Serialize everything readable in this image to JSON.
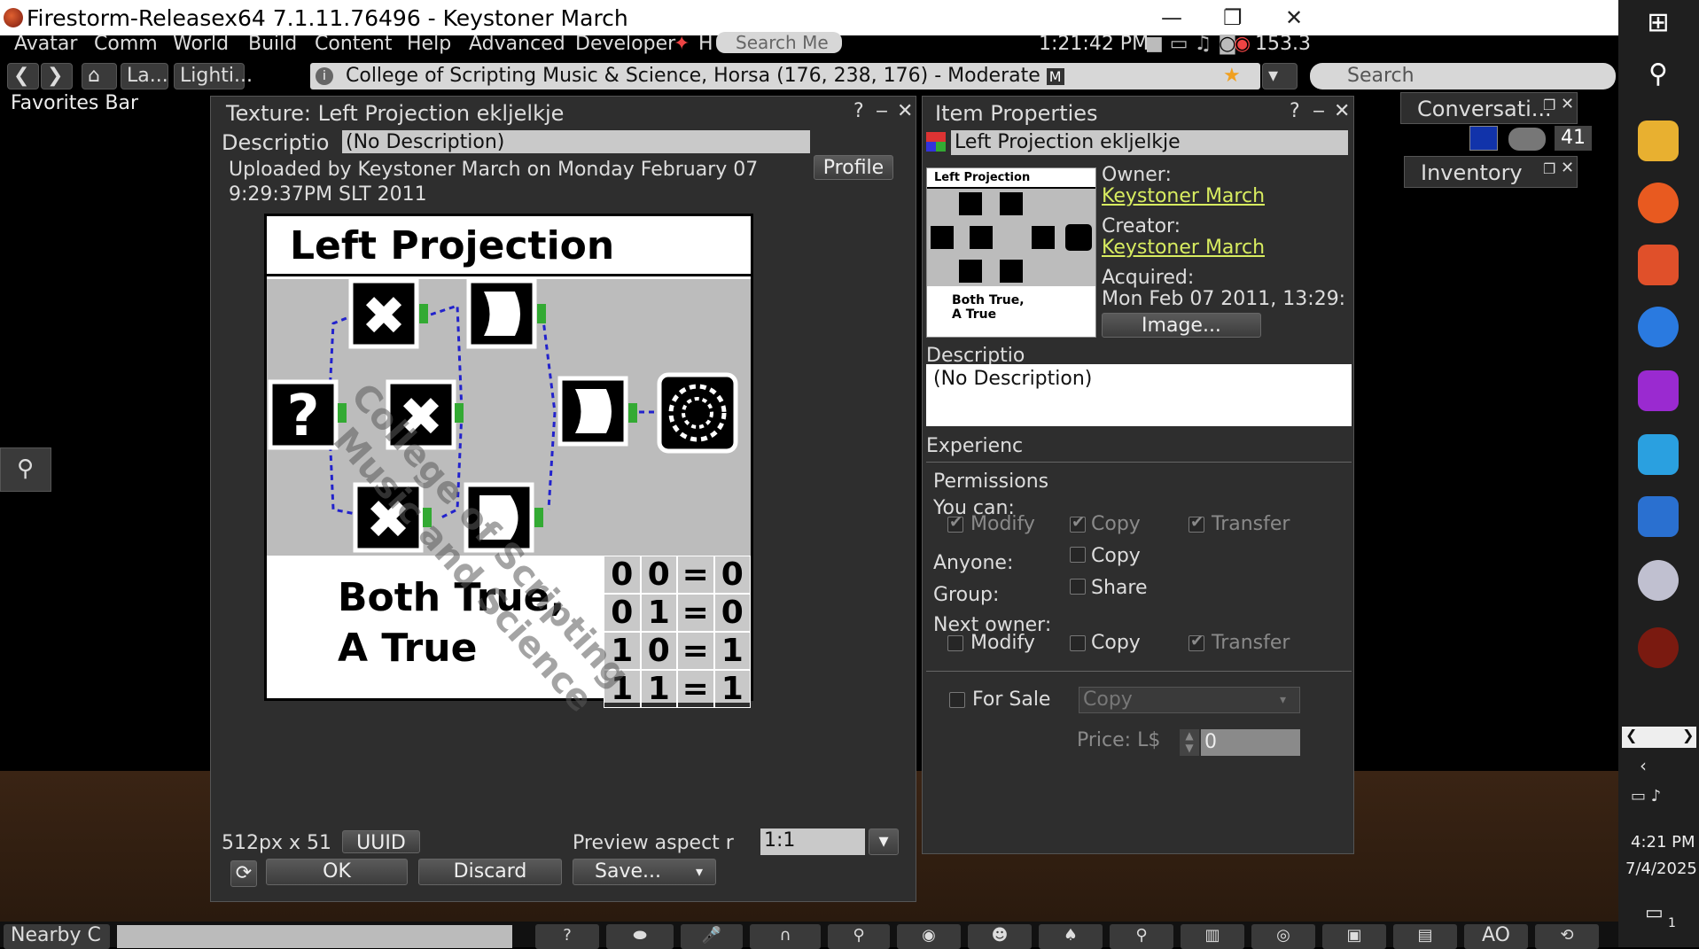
{
  "window": {
    "title": "Firestorm-Releasex64 7.1.11.76496 - Keystoner March",
    "minimize": "—",
    "restore": "❐",
    "close": "✕"
  },
  "menu": {
    "items": [
      "Avatar",
      "Comm",
      "World",
      "Build",
      "Content",
      "Help",
      "Advanced",
      "Developer"
    ],
    "h_label": "H",
    "search_placeholder": "Search Me",
    "clock": "1:21:42 PM",
    "fps": "153.3"
  },
  "nav": {
    "back": "❮",
    "forward": "❯",
    "home": "⌂",
    "landmark": "La...",
    "lighting": "Lighti...",
    "location": "College of Scripting Music & Science, Horsa (176, 238, 176) - Moderate",
    "rating_badge": "M",
    "search_placeholder": "Search",
    "favorites": "Favorites Bar"
  },
  "texture_window": {
    "title": "Texture: Left Projection ekljelkje",
    "help": "?",
    "minimize": "‒",
    "close": "✕",
    "description_label": "Descriptio",
    "description_value": "(No Description)",
    "uploaded_line1": "Uploaded by Keystoner March on Monday February 07",
    "uploaded_line2": "9:29:37PM SLT 2011",
    "profile_button": "Profile",
    "image": {
      "heading": "Left Projection",
      "caption_line1": "Both True,",
      "caption_line2": "A True",
      "watermark_line1": "College of Scripting",
      "watermark_line2": "Music and Science",
      "truth_table": [
        [
          "0",
          "0",
          "=",
          "0"
        ],
        [
          "0",
          "1",
          "=",
          "0"
        ],
        [
          "1",
          "0",
          "=",
          "1"
        ],
        [
          "1",
          "1",
          "=",
          "1"
        ]
      ]
    },
    "dimensions": "512px x 51",
    "uuid_button": "UUID",
    "preview_aspect_label": "Preview aspect r",
    "preview_aspect_value": "1:1",
    "refresh_icon": "⟳",
    "ok_button": "OK",
    "discard_button": "Discard",
    "save_button": "Save..."
  },
  "item_properties": {
    "title": "Item Properties",
    "help": "?",
    "minimize": "‒",
    "close": "✕",
    "name": "Left Projection ekljelkje",
    "thumb_heading": "Left Projection",
    "thumb_caption_line1": "Both True,",
    "thumb_caption_line2": "A True",
    "owner_label": "Owner:",
    "owner_value": "Keystoner March",
    "creator_label": "Creator:",
    "creator_value": "Keystoner March",
    "acquired_label": "Acquired:",
    "acquired_value": "Mon Feb 07 2011, 13:29:",
    "image_button": "Image...",
    "description_label": "Descriptio",
    "description_value": "(No Description)",
    "experience_label": "Experienc",
    "permissions_label": "Permissions",
    "you_can_label": "You can:",
    "modify_label": "Modify",
    "copy_label": "Copy",
    "transfer_label": "Transfer",
    "anyone_label": "Anyone:",
    "anyone_copy": "Copy",
    "group_label": "Group:",
    "group_share": "Share",
    "next_owner_label": "Next owner:",
    "next_modify": "Modify",
    "next_copy": "Copy",
    "next_transfer": "Transfer",
    "for_sale_label": "For Sale",
    "sale_type": "Copy",
    "price_label": "Price: L$",
    "price_value": "0"
  },
  "side_panels": {
    "conversations": "Conversati...",
    "conversations_count": "41",
    "inventory": "Inventory"
  },
  "bottom": {
    "nearby_chat": "Nearby C",
    "ao_label": "AO"
  },
  "taskbar": {
    "time": "4:21 PM",
    "date": "7/4/2025",
    "notification_count": "1"
  },
  "colors": {
    "link": "#d8ec60",
    "panel_bg": "#2e2e2e",
    "title_bg": "#ffffff"
  }
}
